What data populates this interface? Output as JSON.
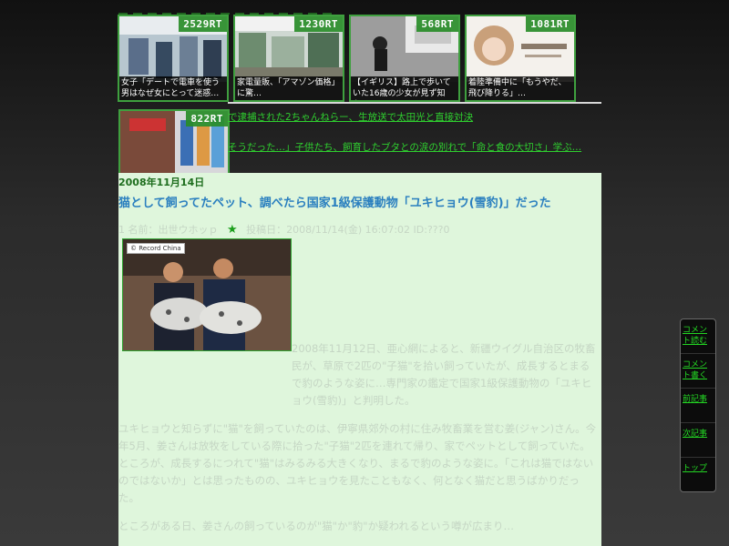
{
  "thumbs": [
    {
      "rt": "2529RT",
      "caption": "女子「デートで電車を使う男はなぜ女にとって迷惑…"
    },
    {
      "rt": "1230RT",
      "caption": "家電量販、「アマゾン価格」に驚…"
    },
    {
      "rt": "568RT",
      "caption": "【イギリス】路上で歩いていた16歳の少女が見ず知ら…"
    },
    {
      "rt": "1081RT",
      "caption": "着陸準備中に「もうやだ、飛び降りる」…"
    },
    {
      "rt": "822RT",
      "caption": ""
    }
  ],
  "links": [
    "で逮捕された2ちゃんねらー、生放送で太田光と直接対決",
    "そうだった…」子供たち、飼育したブタとの涙の別れで「命と食の大切さ」学ぶ…"
  ],
  "article": {
    "date": "2008年11月14日",
    "title": "猫として飼ってたペット、調べたら国家1級保護動物「ユキヒョウ(雪豹)」だった",
    "meta_name": "1 名前：出世ウホッｐ",
    "meta_star": "★",
    "meta_post": "投稿日：2008/11/14(金) 16:07:02 ID:???0",
    "photo_credit": "© Record China",
    "paragraphs": [
      "2008年11月12日、亜心網によると、新疆ウイグル自治区の牧畜民が、草原で2匹の\"子猫\"を拾い飼っていたが、成長するとまるで豹のような姿に…専門家の鑑定で国家1級保護動物の「ユキヒョウ(雪豹)」と判明した。",
      "ユキヒョウと知らずに\"猫\"を飼っていたのは、伊寧県郊外の村に住み牧畜業を営む姜(ジャン)さん。今年5月、姜さんは放牧をしている際に拾った\"子猫\"2匹を連れて帰り、家でペットとして飼っていた。",
      "ところが、成長するにつれて\"猫\"はみるみる大きくなり、まるで豹のような姿に。「これは猫ではないのではないか」とは思ったものの、ユキヒョウを見たこともなく、何となく猫だと思うばかりだった。",
      "ところがある日、姜さんの飼っているのが\"猫\"か\"豹\"か疑われるという噂が広まり…"
    ]
  },
  "side": [
    "コメント読む",
    "コメント書く",
    "前記事",
    "次記事",
    "トップ"
  ]
}
